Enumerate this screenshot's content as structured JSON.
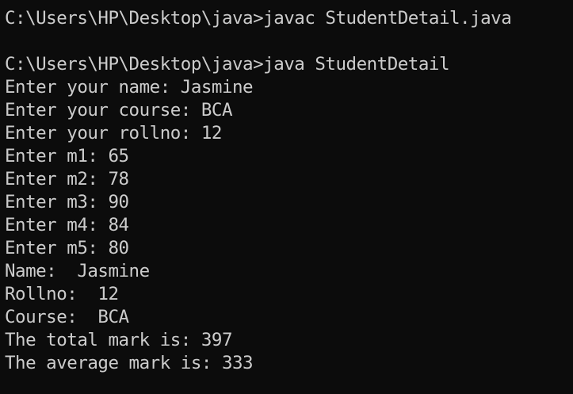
{
  "terminal": {
    "lines": [
      "C:\\Users\\HP\\Desktop\\java>javac StudentDetail.java",
      "",
      "C:\\Users\\HP\\Desktop\\java>java StudentDetail",
      "Enter your name: Jasmine",
      "Enter your course: BCA",
      "Enter your rollno: 12",
      "Enter m1: 65",
      "Enter m2: 78",
      "Enter m3: 90",
      "Enter m4: 84",
      "Enter m5: 80",
      "Name:  Jasmine",
      "Rollno:  12",
      "Course:  BCA",
      "The total mark is: 397",
      "The average mark is: 333"
    ]
  },
  "colors": {
    "background": "#0c0c0c",
    "text": "#cccccc"
  }
}
